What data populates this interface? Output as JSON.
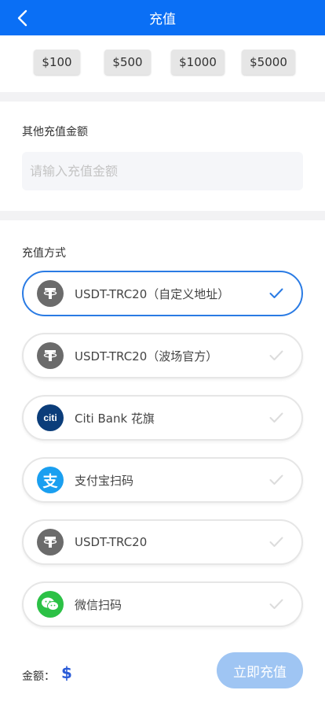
{
  "header": {
    "title": "充值"
  },
  "quick_amounts": [
    "$100",
    "$500",
    "$1000",
    "$5000"
  ],
  "other_amount": {
    "label": "其他充值金额",
    "placeholder": "请输入充值金额",
    "value": ""
  },
  "methods_section": {
    "label": "充值方式",
    "items": [
      {
        "label": "USDT-TRC20（自定义地址）",
        "icon": "tether-icon",
        "selected": true
      },
      {
        "label": "USDT-TRC20（波场官方）",
        "icon": "tether-icon",
        "selected": false
      },
      {
        "label": "Citi Bank 花旗",
        "icon": "citi-icon",
        "selected": false
      },
      {
        "label": "支付宝扫码",
        "icon": "alipay-icon",
        "selected": false
      },
      {
        "label": "USDT-TRC20",
        "icon": "tether-icon",
        "selected": false
      },
      {
        "label": "微信扫码",
        "icon": "wechat-icon",
        "selected": false
      }
    ]
  },
  "footer": {
    "amount_label": "金额：",
    "currency": "$",
    "submit_label": "立即充值"
  },
  "colors": {
    "header_bg": "#0a6ff5",
    "selected_border": "#2a7be4",
    "submit_bg": "#9fc5f3",
    "currency": "#2a5bd7"
  },
  "icon_text": {
    "citi": "citi",
    "alipay": "支"
  }
}
